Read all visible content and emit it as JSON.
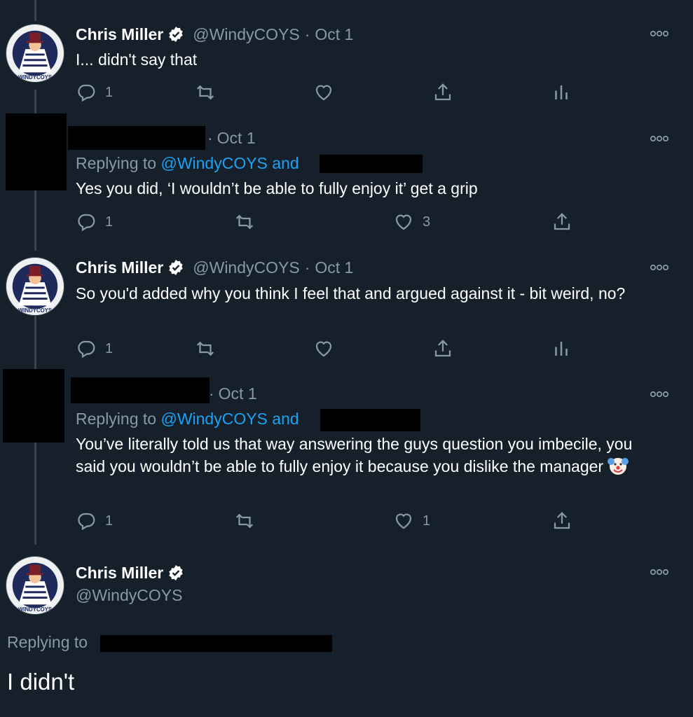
{
  "tweets": [
    {
      "author": "Chris Miller",
      "handle": "@WindyCOYS",
      "date_sep": "·",
      "date": "Oct 1",
      "text": "I... didn't say that",
      "reply_count": "1"
    },
    {
      "date_sep": "·",
      "date": "Oct 1",
      "replying_label": "Replying to",
      "replying_mentions": "@WindyCOYS and",
      "text": "Yes you did, ‘I wouldn’t be able to fully enjoy it’ get a grip",
      "reply_count": "1",
      "like_count": "3"
    },
    {
      "author": "Chris Miller",
      "handle": "@WindyCOYS",
      "date_sep": "·",
      "date": "Oct 1",
      "text": "So you'd added why you think I feel that and argued against it - bit weird, no?",
      "reply_count": "1"
    },
    {
      "date_sep": "·",
      "date": "Oct 1",
      "replying_label": "Replying to",
      "replying_mentions": "@WindyCOYS and",
      "text": "You’ve literally told us that way answering the guys question you imbecile, you said you wouldn’t be able to fully enjoy it because you dislike the manager",
      "reply_count": "1",
      "like_count": "1"
    }
  ],
  "focused": {
    "author": "Chris Miller",
    "handle": "@WindyCOYS",
    "replying_label": "Replying to",
    "text": "I didn't"
  },
  "avatar_text": "WINDYCOYS",
  "icons": [
    "reply-icon",
    "retweet-icon",
    "like-icon",
    "share-icon",
    "analytics-icon",
    "verified-badge-icon",
    "more-options-icon",
    "clown-face-emoji"
  ],
  "colors": {
    "background": "#15202b",
    "muted": "#8899a6",
    "link": "#1da1f2",
    "thread_line": "#38444d"
  }
}
